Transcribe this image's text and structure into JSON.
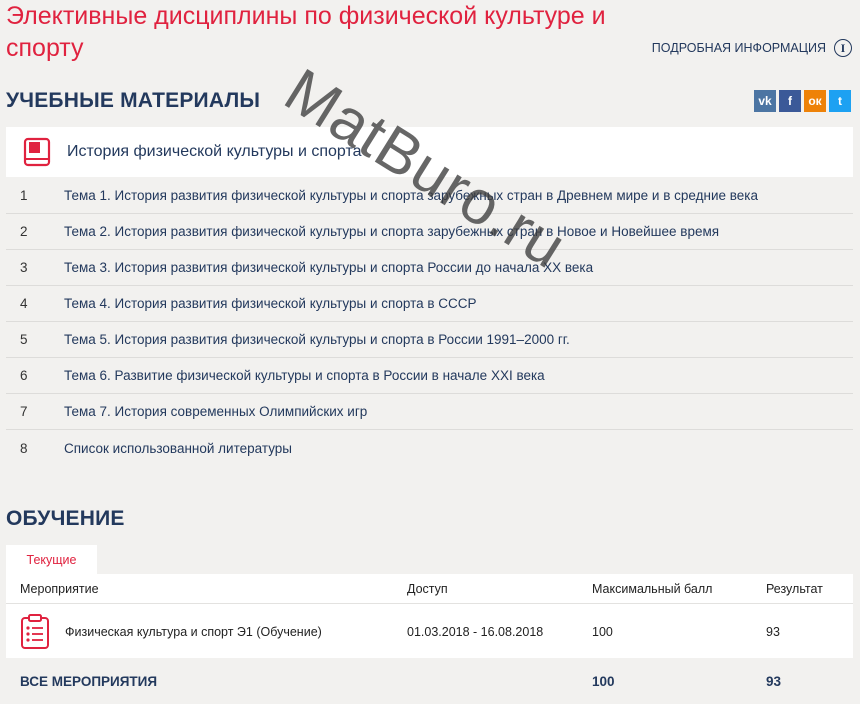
{
  "page_title": "Элективные дисциплины по физической культуре и спорту",
  "more_info_label": "ПОДРОБНАЯ ИНФОРМАЦИЯ",
  "materials": {
    "section_title": "УЧЕБНЫЕ МАТЕРИАЛЫ",
    "course_name": "История физической культуры и спорта",
    "topics": [
      {
        "num": "1",
        "title": "Тема 1. История развития физической культуры и спорта зарубежных стран в Древнем мире и в средние века"
      },
      {
        "num": "2",
        "title": "Тема 2. История развития физической культуры и спорта зарубежных стран в Новое и Новейшее время"
      },
      {
        "num": "3",
        "title": "Тема 3. История развития физической культуры и спорта России до начала XX века"
      },
      {
        "num": "4",
        "title": "Тема 4. История развития физической культуры и спорта в СССР"
      },
      {
        "num": "5",
        "title": "Тема 5. История развития физической культуры и спорта в России 1991–2000 гг."
      },
      {
        "num": "6",
        "title": "Тема 6. Развитие физической культуры и спорта в России в начале XXI века"
      },
      {
        "num": "7",
        "title": "Тема 7. История современных Олимпийских игр"
      },
      {
        "num": "8",
        "title": "Список использованной литературы"
      }
    ]
  },
  "social": {
    "vk": "vk",
    "fb": "f",
    "ok": "ок",
    "tw": "t"
  },
  "learning": {
    "section_title": "ОБУЧЕНИЕ",
    "tab_current": "Текущие",
    "columns": [
      "Мероприятие",
      "Доступ",
      "Максимальный балл",
      "Результат"
    ],
    "events": [
      {
        "name": "Физическая культура и спорт Э1 (Обучение)",
        "access": "01.03.2018 - 16.08.2018",
        "max": "100",
        "result": "93"
      }
    ],
    "total": {
      "label": "ВСЕ МЕРОПРИЯТИЯ",
      "max": "100",
      "result": "93"
    }
  },
  "watermark": "MatBuro.ru",
  "colors": {
    "accent": "#e0223f",
    "navy": "#23395d",
    "background": "#f2f1ef"
  }
}
